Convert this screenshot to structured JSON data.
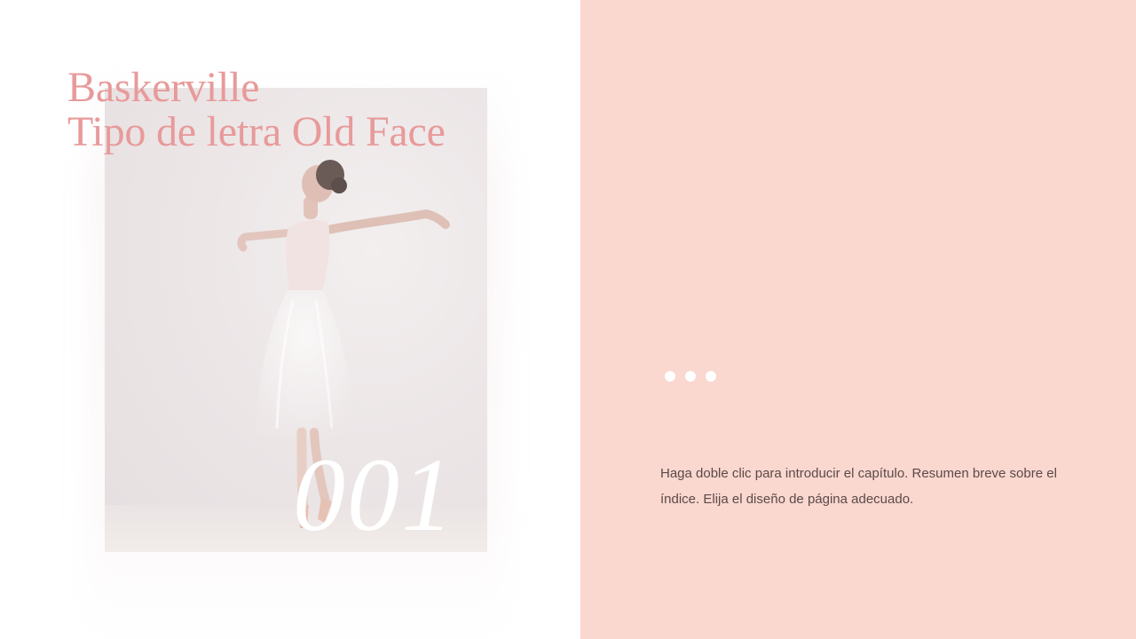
{
  "slide": {
    "title_line1": "Baskerville",
    "title_line2": "Tipo de letra Old Face",
    "chapter_number": "001",
    "summary": "Haga doble clic para introducir el capítulo. Resumen breve sobre el índice. Elija el diseño de página adecuado.",
    "pagination_dots": 3
  },
  "colors": {
    "accent_pink": "#e89a9a",
    "panel_pink": "#fad7cf",
    "body_text": "#5b4a48",
    "white": "#ffffff"
  },
  "images": {
    "photo": "ballerina-photo"
  }
}
